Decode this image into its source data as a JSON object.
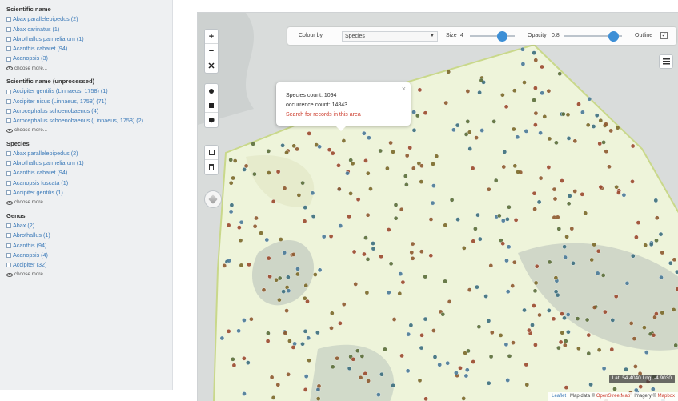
{
  "sidebar": {
    "facets": [
      {
        "title": "Scientific name",
        "items": [
          {
            "label": "Abax parallelepipedus (2)"
          },
          {
            "label": "Abax carinatus (1)"
          },
          {
            "label": "Abrothallus parmeliarum (1)"
          },
          {
            "label": "Acanthis cabaret (94)"
          },
          {
            "label": "Acanopsis (3)"
          }
        ],
        "more_label": "choose more..."
      },
      {
        "title": "Scientific name (unprocessed)",
        "items": [
          {
            "label": "Accipiter gentilis (Linnaeus, 1758) (1)"
          },
          {
            "label": "Accipiter nisus (Linnaeus, 1758) (71)"
          },
          {
            "label": "Acrocephalus schoenobaenus (4)"
          },
          {
            "label": "Acrocephalus schoenobaenus (Linnaeus, 1758) (2)",
            "multiline": true
          }
        ],
        "more_label": "choose more..."
      },
      {
        "title": "Species",
        "items": [
          {
            "label": "Abax parallelepipedus (2)"
          },
          {
            "label": "Abrothallus parmeliarum (1)"
          },
          {
            "label": "Acanthis cabaret (94)"
          },
          {
            "label": "Acanopsis fuscata (1)"
          },
          {
            "label": "Accipiter gentilis (1)"
          }
        ],
        "more_label": "choose more..."
      },
      {
        "title": "Genus",
        "items": [
          {
            "label": "Abax (2)"
          },
          {
            "label": "Abrothallus (1)"
          },
          {
            "label": "Acanthis (94)"
          },
          {
            "label": "Acanopsis (4)"
          },
          {
            "label": "Accipiter (32)"
          }
        ],
        "more_label": "choose more..."
      }
    ]
  },
  "map": {
    "toolbar": {
      "colour_by_label": "Colour by",
      "colour_by_value": "Species",
      "size_label": "Size",
      "size_value": "4",
      "size_level": 0.72,
      "opacity_label": "Opacity",
      "opacity_value": "0.8",
      "opacity_level": 0.85,
      "outline_label": "Outline",
      "outline_checked": true
    },
    "zoom_in_label": "+",
    "zoom_out_label": "−",
    "fullscreen_label": "✕",
    "popup": {
      "species_count": "Species count: 1094",
      "occurrence_count": "occurrence count: 14843",
      "search_link": "Search for records in this area",
      "close": "×"
    },
    "coordinates": "Lat: 54.4040 Lng: -4.9030",
    "attribution": {
      "leaflet": "Leaflet",
      "map_data": "| Map data ©",
      "osm": "OpenStreetMap",
      "imagery": ", Imagery ©",
      "mapbox": "Mapbox"
    },
    "colors": {
      "land": "#d9dcdb",
      "area_fill": "#eef4da",
      "area_outline": "#c9d88a",
      "woodland": "#c5cec2",
      "accent": "#3d8fd6",
      "dots": [
        "#7b6a2a",
        "#8e5a2f",
        "#4a7a98",
        "#5b6e3a",
        "#9b4a2e",
        "#3c6e7e"
      ]
    }
  }
}
